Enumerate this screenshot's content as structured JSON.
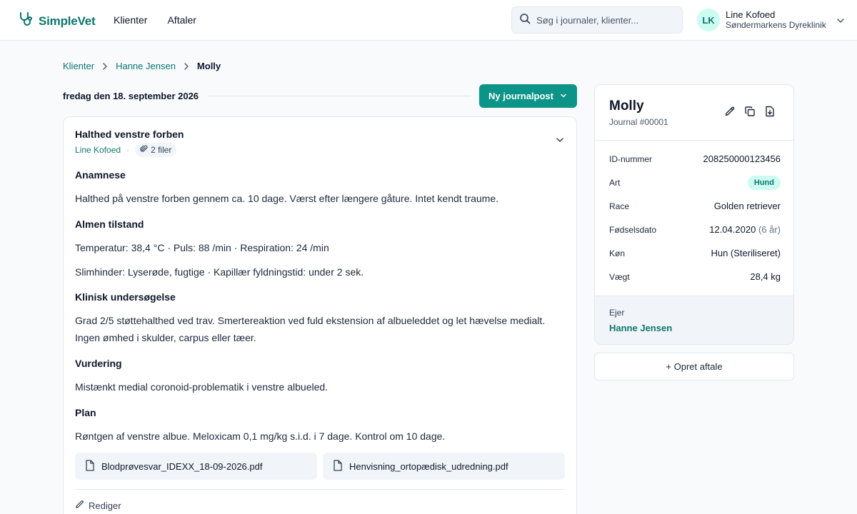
{
  "app": {
    "name": "SimpleVet"
  },
  "nav": {
    "items": [
      "Klienter",
      "Aftaler"
    ]
  },
  "search": {
    "placeholder": "Søg i journaler, klienter..."
  },
  "user": {
    "initials": "LK",
    "name": "Line Kofoed",
    "clinic": "Søndermarkens Dyreklinik"
  },
  "breadcrumb": {
    "items": [
      "Klienter",
      "Hanne Jensen"
    ],
    "current": "Molly"
  },
  "journal": {
    "date": "fredag den 18. september 2026",
    "new_button": "Ny journalpost",
    "entry": {
      "title": "Halthed venstre forben",
      "author": "Line Kofoed",
      "separator": "·",
      "files_badge": "2 filer",
      "sections": [
        {
          "heading": "Anamnese",
          "text": "Halthed på venstre forben gennem ca. 10 dage. Værst efter længere gåture. Intet kendt traume."
        },
        {
          "heading": "Almen tilstand",
          "text": "Temperatur: 38,4 °C · Puls: 88 /min · Respiration: 24 /min",
          "text2": "Slimhinder: Lyserøde, fugtige · Kapillær fyldningstid: under 2 sek."
        },
        {
          "heading": "Klinisk undersøgelse",
          "text": "Grad 2/5 støttehalthed ved trav. Smertereaktion ved fuld ekstension af albueleddet og let hævelse medialt. Ingen ømhed i skulder, carpus eller tæer."
        },
        {
          "heading": "Vurdering",
          "text": "Mistænkt medial coronoid-problematik i venstre albueled."
        },
        {
          "heading": "Plan",
          "text": "Røntgen af venstre albue. Meloxicam 0,1 mg/kg s.i.d. i 7 dage. Kontrol om 10 dage."
        }
      ],
      "attachments": [
        "Blodprøvesvar_IDEXX_18-09-2026.pdf",
        "Henvisning_ortopædisk_udredning.pdf"
      ],
      "edit_label": "Rediger"
    }
  },
  "patient": {
    "name": "Molly",
    "journal_no": "Journal #00001",
    "fields": {
      "id_label": "ID-nummer",
      "id_value": "208250000123456",
      "species_label": "Art",
      "species_value": "Hund",
      "breed_label": "Race",
      "breed_value": "Golden retriever",
      "birth_label": "Fødselsdato",
      "birth_value": "12.04.2020",
      "age_value": "(6 år)",
      "sex_label": "Køn",
      "sex_value": "Hun (Steriliseret)",
      "weight_label": "Vægt",
      "weight_value": "28,4 kg"
    },
    "owner_label": "Ejer",
    "owner_name": "Hanne Jensen"
  },
  "appointment_button": "+ Opret aftale",
  "colors": {
    "accent": "#0d9488",
    "accent_dark": "#0f766e",
    "badge_bg": "#ccfbf1"
  },
  "icons": {
    "logo": "stethoscope-icon",
    "search": "search-icon",
    "edit": "pencil-icon",
    "copy": "copy-icon",
    "download": "download-icon",
    "file": "file-icon",
    "attach": "paperclip-icon"
  }
}
